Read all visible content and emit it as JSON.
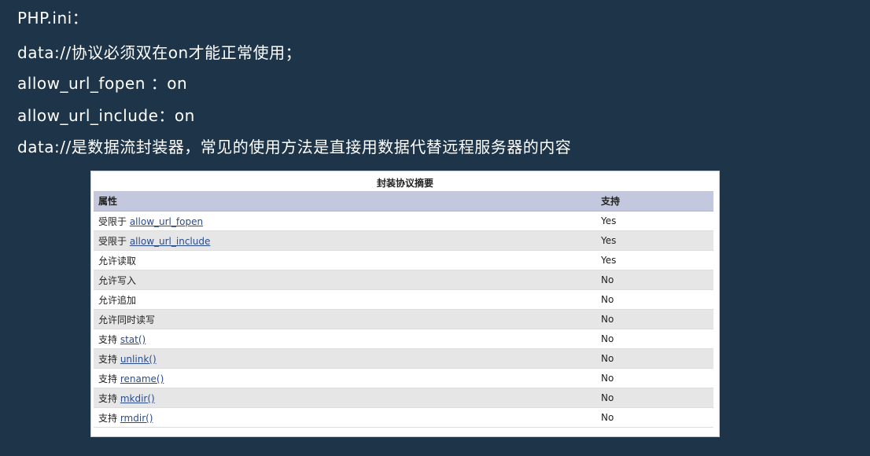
{
  "notes": {
    "line1": "PHP.ini：",
    "line2": "data://协议必须双在on才能正常使用；",
    "line3": "allow_url_fopen ：on",
    "line4": "allow_url_include：on",
    "line5": "data://是数据流封装器，常见的使用方法是直接用数据代替远程服务器的内容"
  },
  "table": {
    "caption": "封装协议摘要",
    "headers": {
      "property": "属性",
      "support": "支持"
    },
    "rows": [
      {
        "prefix": "受限于 ",
        "link": "allow_url_fopen",
        "value": "Yes"
      },
      {
        "prefix": "受限于 ",
        "link": "allow_url_include",
        "value": "Yes"
      },
      {
        "prefix": "允许读取",
        "link": "",
        "value": "Yes"
      },
      {
        "prefix": "允许写入",
        "link": "",
        "value": "No"
      },
      {
        "prefix": "允许追加",
        "link": "",
        "value": "No"
      },
      {
        "prefix": "允许同时读写",
        "link": "",
        "value": "No"
      },
      {
        "prefix": "支持 ",
        "link": "stat()",
        "value": "No"
      },
      {
        "prefix": "支持 ",
        "link": "unlink()",
        "value": "No"
      },
      {
        "prefix": "支持 ",
        "link": "rename()",
        "value": "No"
      },
      {
        "prefix": "支持 ",
        "link": "mkdir()",
        "value": "No"
      },
      {
        "prefix": "支持 ",
        "link": "rmdir()",
        "value": "No"
      }
    ]
  }
}
